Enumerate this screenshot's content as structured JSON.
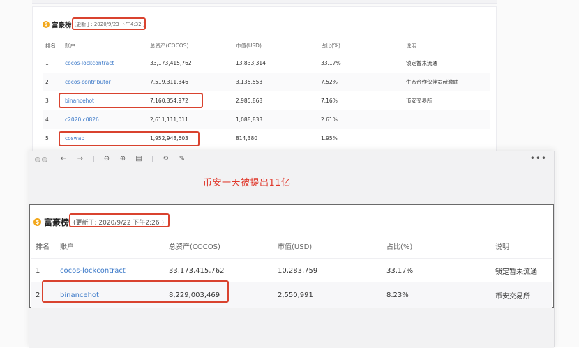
{
  "panel1": {
    "title": "富豪榜",
    "updated": "(更新于: 2020/9/23 下午4:32 )",
    "columns": [
      "排名",
      "账户",
      "总资产(COCOS)",
      "市值(USD)",
      "占比(%)",
      "说明"
    ],
    "rows": [
      {
        "rank": "1",
        "account": "cocos-lockcontract",
        "total": "33,173,415,762",
        "usd": "13,833,314",
        "pct": "33.17%",
        "desc": "锁定暂未流通"
      },
      {
        "rank": "2",
        "account": "cocos-contributor",
        "total": "7,519,311,346",
        "usd": "3,135,553",
        "pct": "7.52%",
        "desc": "生态合作伙伴贡献激励"
      },
      {
        "rank": "3",
        "account": "binancehot",
        "total": "7,160,354,972",
        "usd": "2,985,868",
        "pct": "7.16%",
        "desc": "币安交易所"
      },
      {
        "rank": "4",
        "account": "c2020.c0826",
        "total": "2,611,111,011",
        "usd": "1,088,833",
        "pct": "2.61%",
        "desc": ""
      },
      {
        "rank": "5",
        "account": "coswap",
        "total": "1,952,948,603",
        "usd": "814,380",
        "pct": "1.95%",
        "desc": ""
      }
    ]
  },
  "panel2": {
    "annotation": "币安一天被提出11亿",
    "title": "富豪榜",
    "updated": "(更新于: 2020/9/22 下午2:26 )",
    "columns": [
      "排名",
      "账户",
      "总资产(COCOS)",
      "市值(USD)",
      "占比(%)",
      "说明"
    ],
    "rows": [
      {
        "rank": "1",
        "account": "cocos-lockcontract",
        "total": "33,173,415,762",
        "usd": "10,283,759",
        "pct": "33.17%",
        "desc": "锁定暂未流通"
      },
      {
        "rank": "2",
        "account": "binancehot",
        "total": "8,229,003,469",
        "usd": "2,550,991",
        "pct": "8.23%",
        "desc": "币安交易所"
      }
    ]
  },
  "toolbar": {
    "icons": [
      "back-icon",
      "forward-icon",
      "zoom-out-icon",
      "zoom-in-icon",
      "fit-icon",
      "rotate-icon",
      "markup-icon",
      "more-icon"
    ]
  },
  "colors": {
    "highlight": "#d9432f",
    "link": "#3a78c8",
    "coin": "#f2a81d",
    "annotation": "#e0392c"
  }
}
